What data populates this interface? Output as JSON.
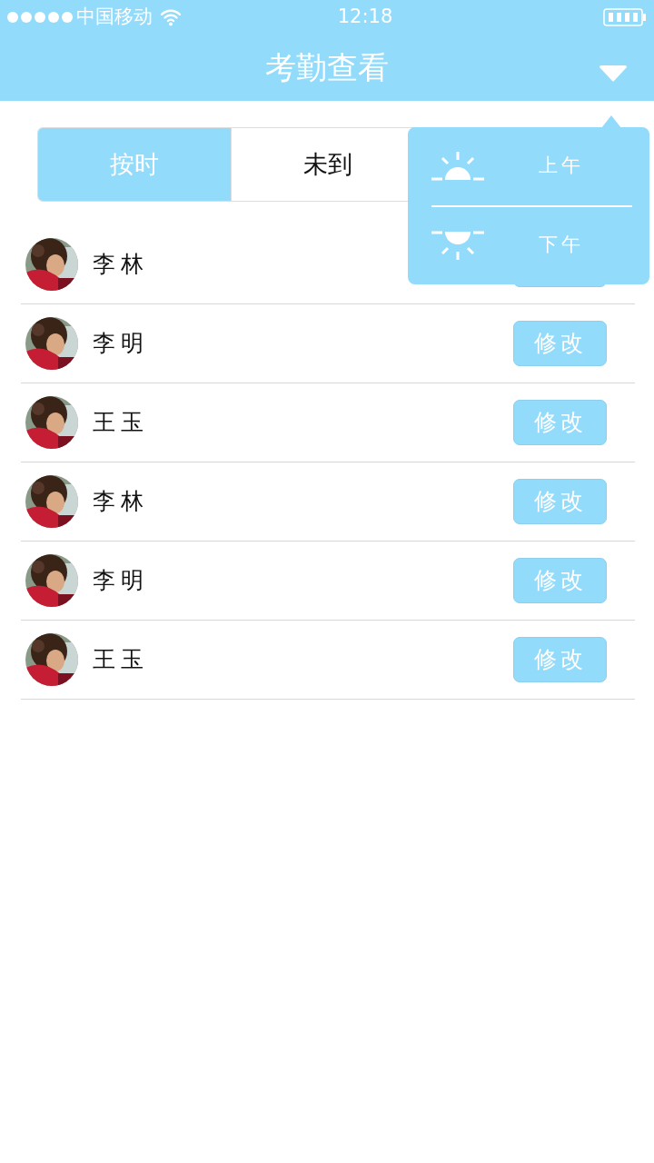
{
  "status_bar": {
    "carrier": "中国移动",
    "time": "12:18"
  },
  "header": {
    "title": "考勤查看"
  },
  "tabs": [
    {
      "label": "按时",
      "selected": true
    },
    {
      "label": "未到",
      "selected": false
    }
  ],
  "rows": [
    {
      "name": "李林"
    },
    {
      "name": "李明",
      "button": "修改"
    },
    {
      "name": "王玉",
      "button": "修改"
    },
    {
      "name": "李林",
      "button": "修改"
    },
    {
      "name": "李明",
      "button": "修改"
    },
    {
      "name": "王玉",
      "button": "修改"
    }
  ],
  "menu": {
    "items": [
      {
        "kind": "rising",
        "label": "上午"
      },
      {
        "kind": "setting",
        "label": "下午"
      }
    ]
  }
}
